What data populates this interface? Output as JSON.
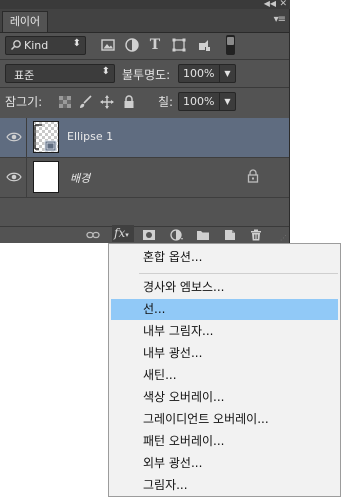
{
  "panel": {
    "tab_label": "레이어",
    "filter": {
      "kind_label": "Kind",
      "icons": [
        "pixel-layer-filter-icon",
        "adjustment-layer-filter-icon",
        "type-layer-filter-icon",
        "shape-layer-filter-icon",
        "smart-object-filter-icon"
      ]
    },
    "blend_mode": "표준",
    "opacity_label": "불투명도:",
    "opacity_value": "100%",
    "lock_label": "잠그기:",
    "fill_label": "칠:",
    "fill_value": "100%",
    "layers": [
      {
        "name": "Ellipse 1",
        "selected": true,
        "visible": true
      },
      {
        "name": "배경",
        "selected": false,
        "visible": true,
        "locked": true
      }
    ],
    "bottom_icons": [
      "link-icon",
      "fx-icon",
      "layer-mask-icon",
      "adjustment-layer-icon",
      "folder-icon",
      "new-layer-icon",
      "trash-icon"
    ],
    "fx_label": "fx"
  },
  "fx_menu": {
    "items": [
      "혼합 옵션...",
      "경사와 엠보스...",
      "선...",
      "내부 그림자...",
      "내부 광선...",
      "새틴...",
      "색상 오버레이...",
      "그레이디언트 오버레이...",
      "패턴 오버레이...",
      "외부 광선...",
      "그림자..."
    ],
    "highlighted_index": 2
  },
  "colors": {
    "panel_bg": "#535353",
    "selected_layer_bg": "#5f6c80",
    "menu_highlight": "#91c9f7"
  }
}
